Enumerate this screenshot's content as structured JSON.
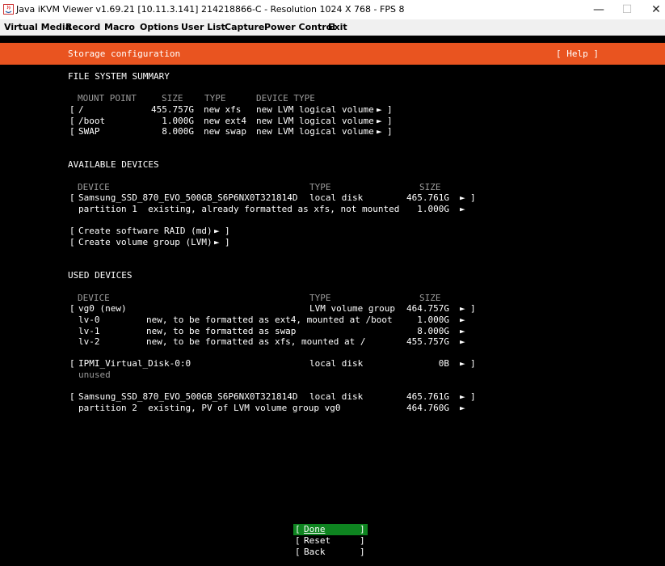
{
  "window": {
    "title": "Java iKVM Viewer v1.69.21 [10.11.3.141] 214218866-C - Resolution 1024 X 768 - FPS 8",
    "controls": {
      "minimize": "—",
      "maximize": "☐",
      "close": "✕"
    }
  },
  "menu": [
    "Virtual Media",
    "Record",
    "Macro",
    "Options",
    "User List",
    "Capture",
    "Power Control",
    "Exit"
  ],
  "header": {
    "title": "Storage configuration",
    "help": "[ Help ]"
  },
  "fs_summary": {
    "heading": "FILE SYSTEM SUMMARY",
    "columns": {
      "mount": "MOUNT POINT",
      "size": "SIZE",
      "type": "TYPE",
      "device_type": "DEVICE TYPE"
    },
    "rows": [
      {
        "mount": "/",
        "size": "455.757G",
        "type": "new xfs",
        "device_type": "new LVM logical volume"
      },
      {
        "mount": "/boot",
        "size": "1.000G",
        "type": "new ext4",
        "device_type": "new LVM logical volume"
      },
      {
        "mount": "SWAP",
        "size": "8.000G",
        "type": "new swap",
        "device_type": "new LVM logical volume"
      }
    ]
  },
  "available": {
    "heading": "AVAILABLE DEVICES",
    "columns": {
      "device": "DEVICE",
      "type": "TYPE",
      "size": "SIZE"
    },
    "disk": {
      "name": "Samsung_SSD_870_EVO_500GB_S6P6NX0T321814D",
      "type": "local disk",
      "size": "465.761G"
    },
    "partition": {
      "desc": "partition 1  existing, already formatted as xfs, not mounted",
      "size": "1.000G"
    },
    "actions": [
      "Create software RAID (md)",
      "Create volume group (LVM)"
    ]
  },
  "used": {
    "heading": "USED DEVICES",
    "columns": {
      "device": "DEVICE",
      "type": "TYPE",
      "size": "SIZE"
    },
    "vg": {
      "name": "vg0 (new)",
      "type": "LVM volume group",
      "size": "464.757G"
    },
    "lvs": [
      {
        "name": "lv-0",
        "desc": "new, to be formatted as ext4, mounted at /boot",
        "size": "1.000G"
      },
      {
        "name": "lv-1",
        "desc": "new, to be formatted as swap",
        "size": "8.000G"
      },
      {
        "name": "lv-2",
        "desc": "new, to be formatted as xfs, mounted at /",
        "size": "455.757G"
      }
    ],
    "ipmi": {
      "name": "IPMI_Virtual_Disk-0:0",
      "type": "local disk",
      "size": "0B",
      "note": "unused"
    },
    "disk": {
      "name": "Samsung_SSD_870_EVO_500GB_S6P6NX0T321814D",
      "type": "local disk",
      "size": "465.761G"
    },
    "partition": {
      "desc": "partition 2  existing, PV of LVM volume group vg0",
      "size": "464.760G"
    }
  },
  "buttons": {
    "done": "Done",
    "reset": "Reset",
    "back": "Back"
  },
  "glyphs": {
    "lbr": "[",
    "rbr": "]",
    "arrow": "►"
  },
  "colors": {
    "banner": "#e95420",
    "selected": "#0e8420",
    "background": "#000000"
  }
}
